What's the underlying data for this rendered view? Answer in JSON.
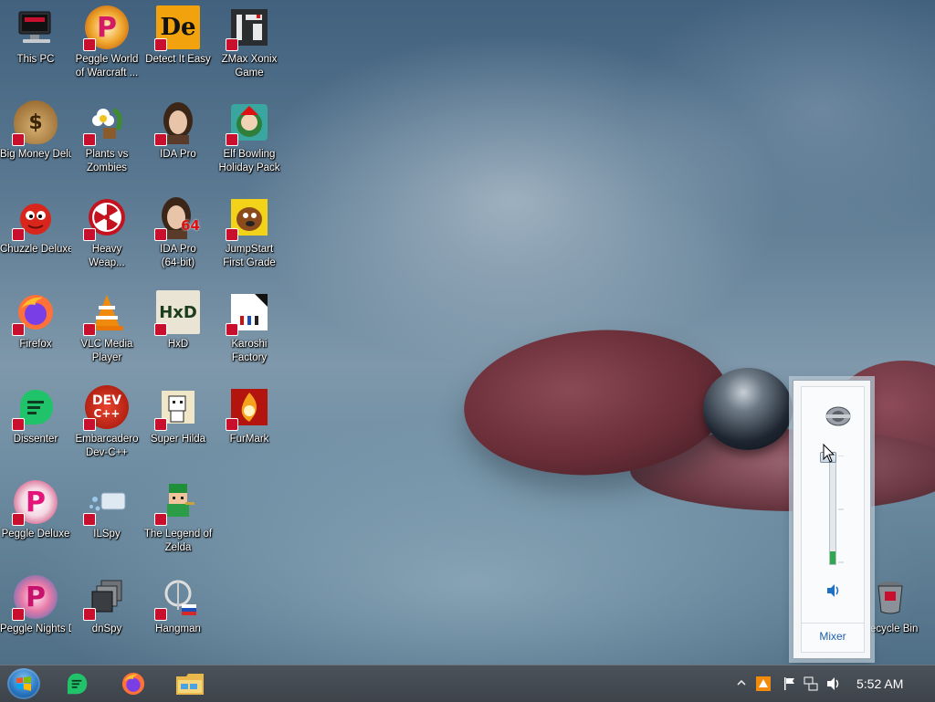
{
  "desktop": {
    "icons": [
      {
        "label": "This PC"
      },
      {
        "label": "Peggle World of Warcraft ..."
      },
      {
        "label": "Detect It Easy"
      },
      {
        "label": "ZMax Xonix Game"
      },
      {
        "label": "Big Money Deluxe"
      },
      {
        "label": "Plants vs Zombies"
      },
      {
        "label": "IDA Pro"
      },
      {
        "label": "Elf Bowling Holiday Pack"
      },
      {
        "label": "Chuzzle Deluxe"
      },
      {
        "label": "Heavy Weap..."
      },
      {
        "label": "IDA Pro (64-bit)"
      },
      {
        "label": "JumpStart First Grade"
      },
      {
        "label": "Firefox"
      },
      {
        "label": "VLC Media Player"
      },
      {
        "label": "HxD"
      },
      {
        "label": "Karoshi Factory"
      },
      {
        "label": "Dissenter"
      },
      {
        "label": "Embarcadero Dev-C++"
      },
      {
        "label": "Super Hilda"
      },
      {
        "label": "FurMark"
      },
      {
        "label": "Peggle Deluxe"
      },
      {
        "label": "ILSpy"
      },
      {
        "label": "The Legend of Zelda"
      },
      {
        "label": "Peggle Nights Deluxe"
      },
      {
        "label": "dnSpy"
      },
      {
        "label": "Hangman"
      },
      {
        "label": "Recycle Bin"
      }
    ]
  },
  "icon_text": {
    "de": "De",
    "dev": "DEV",
    "devpp": "C++",
    "hxd": "HxD",
    "p": "P",
    "money": "$",
    "ida64": "64"
  },
  "volume_flyout": {
    "mixer_label": "Mixer",
    "level_percent": 12
  },
  "taskbar": {
    "clock": "5:52 AM"
  },
  "colors": {
    "accent": "#1f70c1",
    "taskbar": "#3d434a",
    "volume_level": "#2fa84f"
  }
}
